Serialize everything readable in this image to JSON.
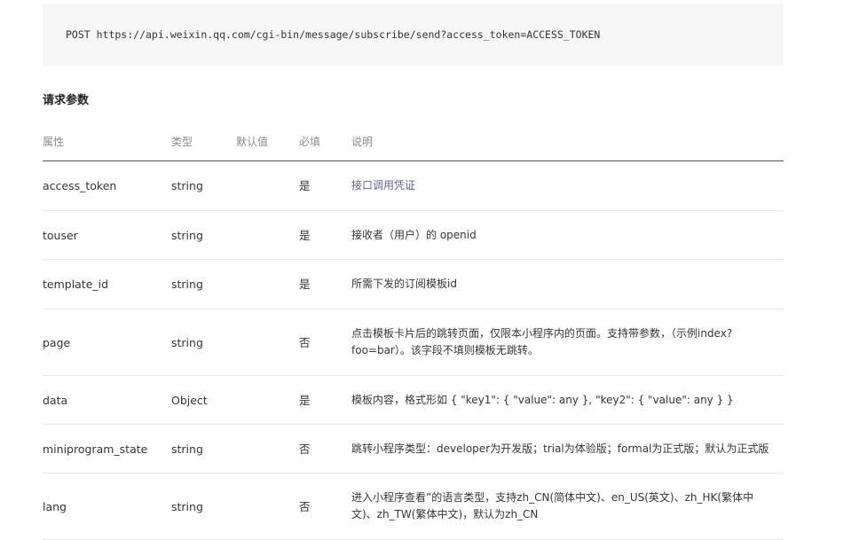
{
  "request": {
    "line": "POST https://api.weixin.qq.com/cgi-bin/message/subscribe/send?access_token=ACCESS_TOKEN"
  },
  "section_title": "请求参数",
  "table": {
    "headers": {
      "name": "属性",
      "type": "类型",
      "default": "默认值",
      "required": "必填",
      "desc": "说明"
    },
    "rows": [
      {
        "name": "access_token",
        "type": "string",
        "default": "",
        "required": "是",
        "desc": "接口调用凭证"
      },
      {
        "name": "touser",
        "type": "string",
        "default": "",
        "required": "是",
        "desc": "接收者（用户）的 openid"
      },
      {
        "name": "template_id",
        "type": "string",
        "default": "",
        "required": "是",
        "desc": "所需下发的订阅模板id"
      },
      {
        "name": "page",
        "type": "string",
        "default": "",
        "required": "否",
        "desc": "点击模板卡片后的跳转页面，仅限本小程序内的页面。支持带参数，（示例index?foo=bar）。该字段不填则模板无跳转。"
      },
      {
        "name": "data",
        "type": "Object",
        "default": "",
        "required": "是",
        "desc": "模板内容，格式形如 { \"key1\": { \"value\": any }, \"key2\": { \"value\": any } }"
      },
      {
        "name": "miniprogram_state",
        "type": "string",
        "default": "",
        "required": "否",
        "desc": "跳转小程序类型：developer为开发版；trial为体验版；formal为正式版；默认为正式版"
      },
      {
        "name": "lang",
        "type": "string",
        "default": "",
        "required": "否",
        "desc": "进入小程序查看”的语言类型，支持zh_CN(简体中文)、en_US(英文)、zh_HK(繁体中文)、zh_TW(繁体中文)，默认为zh_CN"
      }
    ]
  },
  "colors": {
    "link": "#576b95",
    "code_bg": "#f7f7f7",
    "header_text": "#8a8a8a"
  }
}
